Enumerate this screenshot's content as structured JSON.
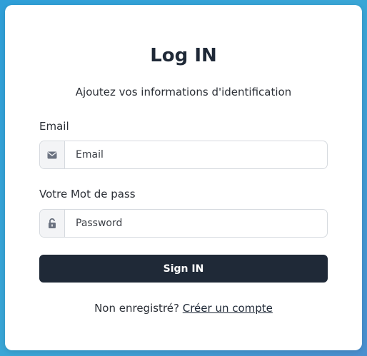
{
  "login": {
    "title": "Log IN",
    "subtitle": "Ajoutez vos informations d'identification",
    "email_label": "Email",
    "email_placeholder": "Email",
    "password_label": "Votre Mot de pass",
    "password_placeholder": "Password",
    "submit_label": "Sign IN",
    "footer_text": "Non enregistré?",
    "footer_link": "Créer un compte"
  },
  "icons": {
    "email": "envelope-icon",
    "password": "unlock-icon"
  },
  "colors": {
    "button_bg": "#1f2937",
    "background": "#2f9fd8"
  }
}
